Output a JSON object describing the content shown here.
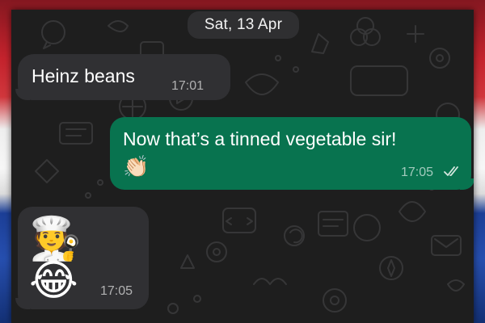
{
  "chat": {
    "date_separator": "Sat, 13 Apr",
    "messages": [
      {
        "direction": "incoming",
        "text": "Heinz beans",
        "time": "17:01"
      },
      {
        "direction": "outgoing",
        "text": "Now that’s a tinned vegetable sir!",
        "emoji": "👏🏻",
        "time": "17:05",
        "status": "read"
      },
      {
        "direction": "incoming",
        "emoji": "🧑‍🍳 😂",
        "time": "17:05"
      }
    ]
  },
  "icons": {
    "read_receipt": "double-check-icon"
  },
  "colors": {
    "chat_background": "#1e1e1e",
    "incoming_bubble": "#303033",
    "outgoing_bubble": "#08734f",
    "date_chip": "#2f2f31",
    "read_tick": "#d7e8e0"
  }
}
